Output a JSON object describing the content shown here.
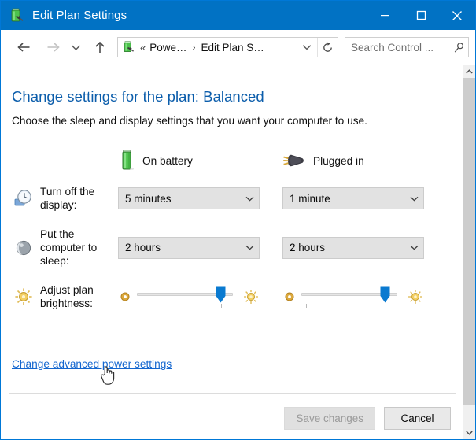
{
  "window": {
    "title": "Edit Plan Settings",
    "title_icon": "battery-plug-icon",
    "titlebar_color": "#0172c4",
    "border_color": "#0078d7",
    "controls": {
      "minimize": "minimize-icon",
      "maximize": "maximize-icon",
      "close": "close-icon"
    }
  },
  "navbar": {
    "back": "back-arrow-icon",
    "forward": "forward-arrow-icon",
    "recent": "chevron-down-icon",
    "up": "up-arrow-icon",
    "refresh": "refresh-icon",
    "breadcrumb": {
      "icon": "power-options-icon",
      "overflow": "«",
      "items": [
        "Powe…",
        "Edit Plan S…"
      ],
      "separator": "›",
      "dropdown": "chevron-down-icon"
    },
    "search": {
      "placeholder": "Search Control ...",
      "value": "",
      "icon": "search-icon"
    }
  },
  "main": {
    "heading": "Change settings for the plan: Balanced",
    "plan_name": "Balanced",
    "subheading": "Choose the sleep and display settings that you want your computer to use.",
    "heading_color": "#0b5dab",
    "columns": [
      {
        "label": "On battery",
        "icon": "battery-icon"
      },
      {
        "label": "Plugged in",
        "icon": "power-plug-icon"
      }
    ],
    "rows": [
      {
        "icon": "display-clock-icon",
        "label": "Turn off the display:",
        "type": "combobox",
        "on_battery": "5 minutes",
        "plugged_in": "1 minute"
      },
      {
        "icon": "sleep-moon-icon",
        "label": "Put the computer to sleep:",
        "type": "combobox",
        "on_battery": "2 hours",
        "plugged_in": "2 hours"
      },
      {
        "icon": "brightness-sun-icon",
        "label": "Adjust plan brightness:",
        "type": "slider",
        "dim_icon": "dim-brightness-icon",
        "bright_icon": "bright-brightness-icon",
        "on_battery_percent": 88,
        "plugged_in_percent": 88,
        "thumb_color": "#0a7ad0"
      }
    ],
    "advanced_link": "Change advanced power settings",
    "link_color": "#1366cf",
    "cursor": "hand-pointer-cursor"
  },
  "footer": {
    "save_label": "Save changes",
    "save_enabled": false,
    "cancel_label": "Cancel"
  },
  "scrollbar": {
    "up": "scroll-up-arrow-icon",
    "down": "scroll-down-arrow-icon",
    "thumb": "scrollbar-thumb"
  }
}
